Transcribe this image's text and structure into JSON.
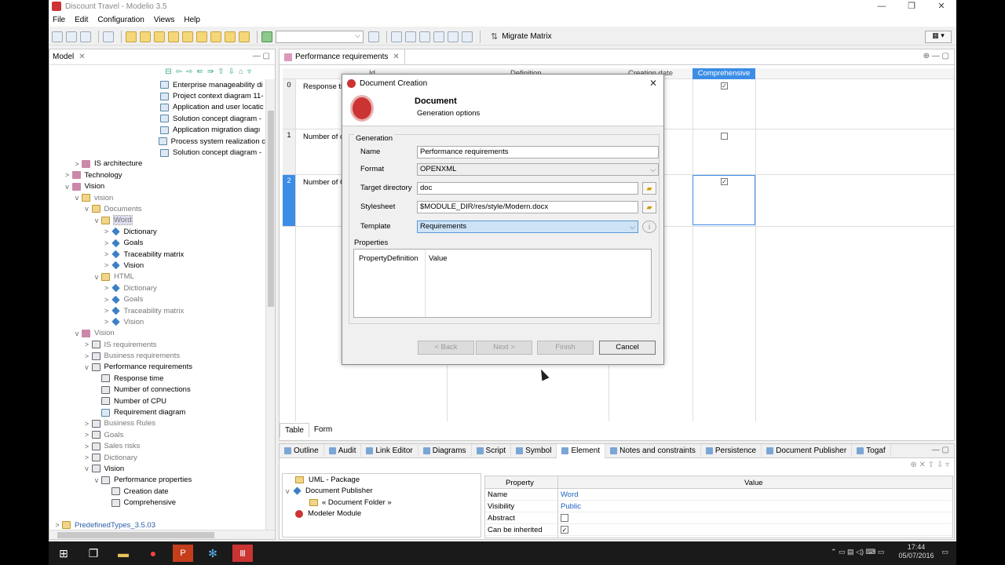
{
  "window": {
    "title": "Discount Travel - Modelio 3.5"
  },
  "menu": [
    "File",
    "Edit",
    "Configuration",
    "Views",
    "Help"
  ],
  "toolbar": {
    "migrate_label": "Migrate Matrix"
  },
  "model_panel": {
    "tab": "Model",
    "tree": [
      {
        "label": "Enterprise manageability di",
        "indent": 10,
        "icon": "diag",
        "twisty": ""
      },
      {
        "label": "Project context diagram 11-",
        "indent": 10,
        "icon": "diag",
        "twisty": ""
      },
      {
        "label": "Application and user locatic",
        "indent": 10,
        "icon": "diag",
        "twisty": ""
      },
      {
        "label": "Solution concept diagram -",
        "indent": 10,
        "icon": "diag",
        "twisty": ""
      },
      {
        "label": "Application migration diagı",
        "indent": 10,
        "icon": "diag",
        "twisty": ""
      },
      {
        "label": "Process system realization c",
        "indent": 10,
        "icon": "diag",
        "twisty": ""
      },
      {
        "label": "Solution concept diagram -",
        "indent": 10,
        "icon": "diag",
        "twisty": ""
      },
      {
        "label": "IS architecture",
        "indent": 2,
        "icon": "mod",
        "twisty": ">"
      },
      {
        "label": "Technology",
        "indent": 1,
        "icon": "mod",
        "twisty": ">"
      },
      {
        "label": "Vision",
        "indent": 1,
        "icon": "mod",
        "twisty": "v"
      },
      {
        "label": "vision",
        "indent": 2,
        "icon": "pkg",
        "twisty": "v",
        "grey": true
      },
      {
        "label": "Documents",
        "indent": 3,
        "icon": "pkg",
        "twisty": "v",
        "grey": true
      },
      {
        "label": "Word",
        "indent": 4,
        "icon": "pkg",
        "twisty": "v",
        "grey": true,
        "selected": true
      },
      {
        "label": "Dictionary",
        "indent": 5,
        "icon": "doc",
        "twisty": ">"
      },
      {
        "label": "Goals",
        "indent": 5,
        "icon": "doc",
        "twisty": ">"
      },
      {
        "label": "Traceability matrix",
        "indent": 5,
        "icon": "doc",
        "twisty": ">"
      },
      {
        "label": "Vision",
        "indent": 5,
        "icon": "doc",
        "twisty": ">"
      },
      {
        "label": "HTML",
        "indent": 4,
        "icon": "pkg",
        "twisty": "v",
        "grey": true
      },
      {
        "label": "Dictionary",
        "indent": 5,
        "icon": "doc",
        "twisty": ">",
        "grey": true
      },
      {
        "label": "Goals",
        "indent": 5,
        "icon": "doc",
        "twisty": ">",
        "grey": true
      },
      {
        "label": "Traceability matrix",
        "indent": 5,
        "icon": "doc",
        "twisty": ">",
        "grey": true
      },
      {
        "label": "Vision",
        "indent": 5,
        "icon": "doc",
        "twisty": ">",
        "grey": true
      },
      {
        "label": "Vision",
        "indent": 2,
        "icon": "mod",
        "twisty": "v",
        "grey": true
      },
      {
        "label": "IS requirements",
        "indent": 3,
        "icon": "req",
        "twisty": ">",
        "grey": true
      },
      {
        "label": "Business requirements",
        "indent": 3,
        "icon": "req",
        "twisty": ">",
        "grey": true
      },
      {
        "label": "Performance requirements",
        "indent": 3,
        "icon": "req",
        "twisty": "v"
      },
      {
        "label": "Response time",
        "indent": 4,
        "icon": "req",
        "twisty": ""
      },
      {
        "label": "Number of connections",
        "indent": 4,
        "icon": "req",
        "twisty": ""
      },
      {
        "label": "Number of CPU",
        "indent": 4,
        "icon": "req",
        "twisty": ""
      },
      {
        "label": "Requirement diagram",
        "indent": 4,
        "icon": "diag",
        "twisty": ""
      },
      {
        "label": "Business Rules",
        "indent": 3,
        "icon": "req",
        "twisty": ">",
        "grey": true
      },
      {
        "label": "Goals",
        "indent": 3,
        "icon": "req",
        "twisty": ">",
        "grey": true
      },
      {
        "label": "Sales risks",
        "indent": 3,
        "icon": "req",
        "twisty": ">",
        "grey": true
      },
      {
        "label": "Dictionary",
        "indent": 3,
        "icon": "req",
        "twisty": ">",
        "grey": true
      },
      {
        "label": "Vision",
        "indent": 3,
        "icon": "req",
        "twisty": "v"
      },
      {
        "label": "Performance properties",
        "indent": 4,
        "icon": "req",
        "twisty": "v"
      },
      {
        "label": "Creation date",
        "indent": 5,
        "icon": "req",
        "twisty": ""
      },
      {
        "label": "Comprehensive",
        "indent": 5,
        "icon": "req",
        "twisty": ""
      },
      {
        "label": "",
        "indent": 0,
        "icon": "",
        "twisty": ""
      },
      {
        "label": "PredefinedTypes_3.5.03",
        "indent": 0,
        "icon": "pkg",
        "twisty": ">",
        "blue": true
      }
    ]
  },
  "editor": {
    "tab": "Performance requirements",
    "headers": {
      "id": "Id",
      "definition": "Definition",
      "creation": "Creation date",
      "comprehensive": "Comprehensive"
    },
    "rows": [
      {
        "num": "0",
        "text": "Response ti",
        "checked": "✓"
      },
      {
        "num": "1",
        "text": "Number of c",
        "checked": ""
      },
      {
        "num": "2",
        "text": "Number of C",
        "checked": "✓"
      }
    ],
    "bottom_tabs": [
      "Table",
      "Form"
    ]
  },
  "dialog": {
    "title": "Document Creation",
    "banner_title": "Document",
    "banner_subtitle": "Generation options",
    "group": "Generation",
    "name_label": "Name",
    "name_value": "Performance requirements",
    "format_label": "Format",
    "format_value": "OPENXML",
    "target_label": "Target directory",
    "target_value": "doc",
    "stylesheet_label": "Stylesheet",
    "stylesheet_value": "$MODULE_DIR/res/style/Modern.docx",
    "template_label": "Template",
    "template_value": "Requirements",
    "properties_label": "Properties",
    "prop_col1": "PropertyDefinition",
    "prop_col2": "Value",
    "btn_back": "< Back",
    "btn_next": "Next >",
    "btn_finish": "Finish",
    "btn_cancel": "Cancel"
  },
  "bottom_panel": {
    "tabs": [
      "Outline",
      "Audit",
      "Link Editor",
      "Diagrams",
      "Script",
      "Symbol",
      "Element",
      "Notes and constraints",
      "Persistence",
      "Document Publisher",
      "Togaf"
    ],
    "tree": [
      "UML - Package",
      "Document Publisher",
      "« Document Folder »",
      "Modeler Module"
    ],
    "property_header": "Property",
    "value_header": "Value",
    "properties": [
      {
        "name": "Name",
        "value": "Word"
      },
      {
        "name": "Visibility",
        "value": "Public"
      },
      {
        "name": "Abstract",
        "value": ""
      },
      {
        "name": "Can be inherited",
        "value": "✓"
      }
    ]
  },
  "taskbar": {
    "time": "17:44",
    "date": "05/07/2016"
  }
}
